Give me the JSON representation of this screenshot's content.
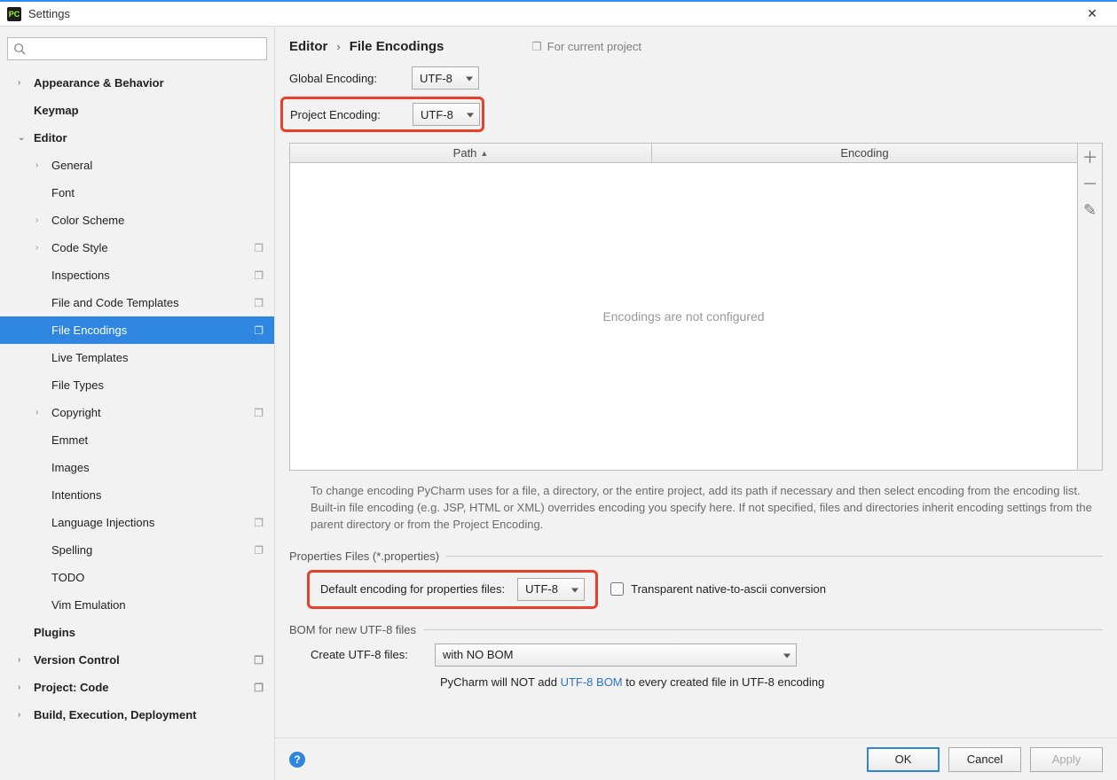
{
  "window": {
    "title": "Settings",
    "app_icon_text": "PC"
  },
  "breadcrumb": {
    "part1": "Editor",
    "part2": "File Encodings",
    "for_project": "For current project"
  },
  "global_encoding": {
    "label": "Global Encoding:",
    "value": "UTF-8"
  },
  "project_encoding": {
    "label": "Project Encoding:",
    "value": "UTF-8"
  },
  "table": {
    "col_path": "Path",
    "col_encoding": "Encoding",
    "empty": "Encodings are not configured"
  },
  "help_text": "To change encoding PyCharm uses for a file, a directory, or the entire project, add its path if necessary and then select encoding from the encoding list. Built-in file encoding (e.g. JSP, HTML or XML) overrides encoding you specify here. If not specified, files and directories inherit encoding settings from the parent directory or from the Project Encoding.",
  "properties": {
    "section": "Properties Files (*.properties)",
    "label": "Default encoding for properties files:",
    "value": "UTF-8",
    "checkbox_label": "Transparent native-to-ascii conversion"
  },
  "bom": {
    "section": "BOM for new UTF-8 files",
    "label": "Create UTF-8 files:",
    "value": "with NO BOM",
    "note_prefix": "PyCharm will NOT add ",
    "note_link": "UTF-8 BOM",
    "note_suffix": " to every created file in UTF-8 encoding"
  },
  "buttons": {
    "ok": "OK",
    "cancel": "Cancel",
    "apply": "Apply"
  },
  "tree": [
    {
      "label": "Appearance & Behavior",
      "depth": 0,
      "bold": true,
      "arrow": "›"
    },
    {
      "label": "Keymap",
      "depth": 0,
      "bold": true
    },
    {
      "label": "Editor",
      "depth": 0,
      "bold": true,
      "arrow": "⌄"
    },
    {
      "label": "General",
      "depth": 1,
      "arrow": "›"
    },
    {
      "label": "Font",
      "depth": 1
    },
    {
      "label": "Color Scheme",
      "depth": 1,
      "arrow": "›"
    },
    {
      "label": "Code Style",
      "depth": 1,
      "arrow": "›",
      "proj": true
    },
    {
      "label": "Inspections",
      "depth": 1,
      "proj": true
    },
    {
      "label": "File and Code Templates",
      "depth": 1,
      "proj": true
    },
    {
      "label": "File Encodings",
      "depth": 1,
      "proj": true,
      "selected": true
    },
    {
      "label": "Live Templates",
      "depth": 1
    },
    {
      "label": "File Types",
      "depth": 1
    },
    {
      "label": "Copyright",
      "depth": 1,
      "arrow": "›",
      "proj": true
    },
    {
      "label": "Emmet",
      "depth": 1
    },
    {
      "label": "Images",
      "depth": 1
    },
    {
      "label": "Intentions",
      "depth": 1
    },
    {
      "label": "Language Injections",
      "depth": 1,
      "proj": true
    },
    {
      "label": "Spelling",
      "depth": 1,
      "proj": true
    },
    {
      "label": "TODO",
      "depth": 1
    },
    {
      "label": "Vim Emulation",
      "depth": 1
    },
    {
      "label": "Plugins",
      "depth": 0,
      "bold": true
    },
    {
      "label": "Version Control",
      "depth": 0,
      "bold": true,
      "arrow": "›",
      "proj": true
    },
    {
      "label": "Project: Code",
      "depth": 0,
      "bold": true,
      "arrow": "›",
      "proj": true
    },
    {
      "label": "Build, Execution, Deployment",
      "depth": 0,
      "bold": true,
      "arrow": "›"
    }
  ]
}
